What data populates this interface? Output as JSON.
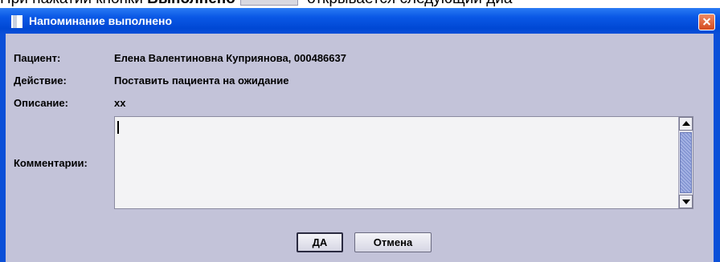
{
  "doc_line": {
    "prefix": "При нажатии кнопки ",
    "bold": "Выполнено",
    "suffix": " открывается следующий диа"
  },
  "dialog": {
    "title": "Напоминание выполнено",
    "fields": {
      "patient_label": "Пациент:",
      "patient_value": "Елена Валентиновна Куприянова, 000486637",
      "action_label": "Действие:",
      "action_value": "Поставить пациента на ожидание",
      "description_label": "Описание:",
      "description_value": "xx",
      "comments_label": "Комментарии:",
      "comments_value": ""
    },
    "buttons": {
      "ok": "ДА",
      "cancel": "Отмена"
    }
  },
  "colors": {
    "titlebar": "#0a58e6",
    "content_bg": "#c3c3d9",
    "close_button": "#d44a1e"
  }
}
